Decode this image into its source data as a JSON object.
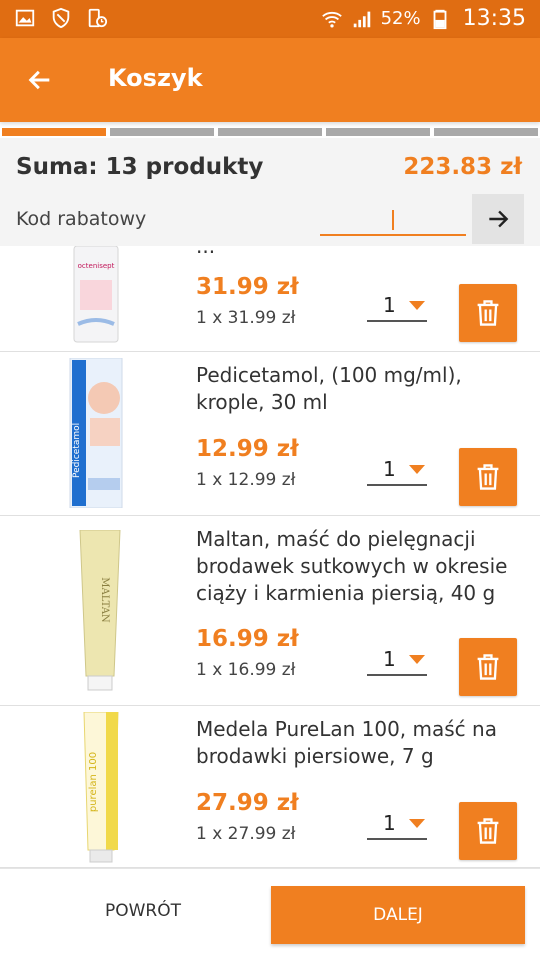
{
  "status_bar": {
    "battery": "52%",
    "time": "13:35"
  },
  "app_bar": {
    "title": "Koszyk"
  },
  "summary": {
    "label": "Suma: 13 produkty",
    "total": "223.83 zł",
    "promo_label": "Kod rabatowy",
    "promo_value": ""
  },
  "items": [
    {
      "name": "",
      "partial_name": "...",
      "price": "31.99 zł",
      "unit": "1 x 31.99 zł",
      "qty": "1",
      "thumb_text": "octenisept"
    },
    {
      "name_line1": "Pedicetamol, (100 mg/ml),",
      "name_line2": "krople, 30 ml",
      "price": "12.99 zł",
      "unit": "1 x 12.99 zł",
      "qty": "1",
      "thumb_text": "Pedicetamol"
    },
    {
      "name_line1": "Maltan, maść do pielęgnacji",
      "name_line2": "brodawek sutkowych w okresie",
      "name_line3": "ciąży i karmienia piersią, 40 g",
      "price": "16.99 zł",
      "unit": "1 x 16.99 zł",
      "qty": "1",
      "thumb_text": "MALTAN"
    },
    {
      "name_line1": "Medela PureLan 100, maść na",
      "name_line2": "brodawki piersiowe, 7 g",
      "price": "27.99 zł",
      "unit": "1 x 27.99 zł",
      "qty": "1",
      "thumb_text": "purelan 100"
    }
  ],
  "bottom": {
    "back_label": "POWRÓT",
    "next_label": "DALEJ"
  },
  "colors": {
    "primary": "#f07f20",
    "status": "#e06d12"
  }
}
